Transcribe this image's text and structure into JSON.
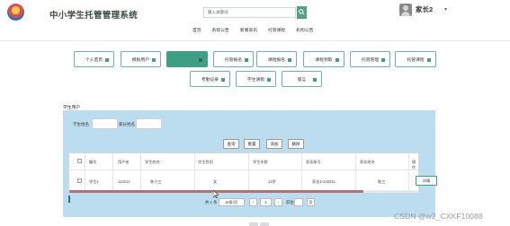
{
  "header": {
    "title": "中小学生托管管理系统",
    "search_placeholder": "输入关键词",
    "user_name": "家长2",
    "user_caret": "▼",
    "nav": [
      "首页",
      "系统公告",
      "新闻资讯",
      "托管课程",
      "机构公告"
    ]
  },
  "menu": {
    "row1": [
      "个人首页",
      "模板用户",
      "",
      "托管报名",
      "课程报名",
      "课程领取",
      "托管管理",
      "托管课程"
    ],
    "row2": [
      "考勤记录",
      "学生请假",
      "留言"
    ],
    "active_index": 2
  },
  "breadcrumb": "学生用户",
  "filters": {
    "student_name_label": "学生姓名",
    "parent_name_label": "家长姓名"
  },
  "actions": [
    "查询",
    "重置",
    "添加",
    "删除"
  ],
  "table": {
    "headers": [
      "编号",
      "用户名",
      "学生姓名",
      "学生性别",
      "学生年龄",
      "家长账号",
      "家长姓名",
      "操作"
    ],
    "rows": [
      {
        "id": "学生1",
        "username": "112212",
        "name": "陈小三",
        "gender": "女",
        "age": "12岁",
        "parent_account": "家长2-132211",
        "parent_name": "陈三",
        "action": "详情"
      }
    ]
  },
  "pager": {
    "total": "共 1 条",
    "page_size": "10条/页",
    "prev": "‹",
    "current": "1",
    "next": "›",
    "goto_prefix": "前往",
    "goto_suffix": "页"
  },
  "watermark": "CSDN @w2_CXKF10088",
  "colors": {
    "accent": "#3f9f84",
    "panel": "#bcdcef"
  }
}
